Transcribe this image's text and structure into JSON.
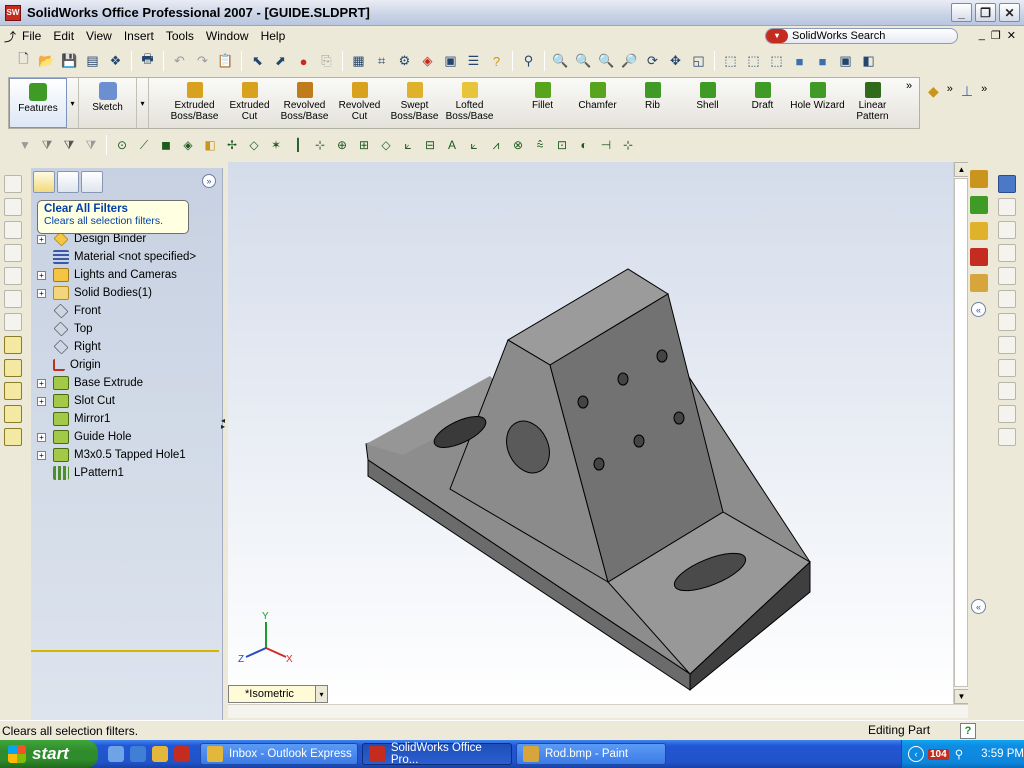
{
  "window": {
    "title": "SolidWorks Office Professional 2007 - [GUIDE.SLDPRT]",
    "app_icon": "SW"
  },
  "menu": {
    "items": [
      "File",
      "Edit",
      "View",
      "Insert",
      "Tools",
      "Window",
      "Help"
    ],
    "search_label": "SolidWorks Search"
  },
  "command_manager": {
    "tabs": [
      {
        "label": "Features",
        "icon": "features-icon"
      },
      {
        "label": "Sketch",
        "icon": "sketch-icon"
      }
    ],
    "commands": [
      {
        "label": "Extruded Boss/Base",
        "icon": "extruded-boss-icon",
        "color": "#d9a21e"
      },
      {
        "label": "Extruded Cut",
        "icon": "extruded-cut-icon",
        "color": "#d9a21e"
      },
      {
        "label": "Revolved Boss/Base",
        "icon": "revolved-boss-icon",
        "color": "#c07b1b"
      },
      {
        "label": "Revolved Cut",
        "icon": "revolved-cut-icon",
        "color": "#d9a21e"
      },
      {
        "label": "Swept Boss/Base",
        "icon": "swept-boss-icon",
        "color": "#e0b22c"
      },
      {
        "label": "Lofted Boss/Base",
        "icon": "lofted-boss-icon",
        "color": "#e8c43a"
      },
      {
        "label": "Fillet",
        "icon": "fillet-icon",
        "color": "#57a51c"
      },
      {
        "label": "Chamfer",
        "icon": "chamfer-icon",
        "color": "#57a51c"
      },
      {
        "label": "Rib",
        "icon": "rib-icon",
        "color": "#3f9a26"
      },
      {
        "label": "Shell",
        "icon": "shell-icon",
        "color": "#3f9a26"
      },
      {
        "label": "Draft",
        "icon": "draft-icon",
        "color": "#3f9a26"
      },
      {
        "label": "Hole Wizard",
        "icon": "hole-wizard-icon",
        "color": "#3f9a26"
      },
      {
        "label": "Linear Pattern",
        "icon": "linear-pattern-icon",
        "color": "#2f6b1b"
      }
    ]
  },
  "tooltip": {
    "title": "Clear All Filters",
    "body": "Clears all selection filters."
  },
  "feature_tree": {
    "nodes": [
      {
        "label": "Design Binder",
        "icon": "binder",
        "expand": "+"
      },
      {
        "label": "Material <not specified>",
        "icon": "mat",
        "expand": ""
      },
      {
        "label": "Lights and Cameras",
        "icon": "lights",
        "expand": "+"
      },
      {
        "label": "Solid Bodies(1)",
        "icon": "folder",
        "expand": "+"
      },
      {
        "label": "Front",
        "icon": "plane",
        "expand": ""
      },
      {
        "label": "Top",
        "icon": "plane",
        "expand": ""
      },
      {
        "label": "Right",
        "icon": "plane",
        "expand": ""
      },
      {
        "label": "Origin",
        "icon": "origin",
        "expand": ""
      },
      {
        "label": "Base Extrude",
        "icon": "feat",
        "expand": "+"
      },
      {
        "label": "Slot Cut",
        "icon": "feat",
        "expand": "+"
      },
      {
        "label": "Mirror1",
        "icon": "feat",
        "expand": ""
      },
      {
        "label": "Guide Hole",
        "icon": "feat",
        "expand": "+"
      },
      {
        "label": "M3x0.5 Tapped Hole1",
        "icon": "feat",
        "expand": "+"
      },
      {
        "label": "LPattern1",
        "icon": "pattern",
        "expand": ""
      }
    ]
  },
  "viewport": {
    "view_name": "*Isometric",
    "triad": {
      "x": "X",
      "y": "Y",
      "z": "Z"
    }
  },
  "status": {
    "message": "Clears all selection filters.",
    "mode": "Editing Part",
    "help": "?"
  },
  "taskbar": {
    "start_label": "start",
    "tasks": [
      {
        "label": "Inbox - Outlook Express",
        "active": false,
        "icon": "outlook-icon"
      },
      {
        "label": "SolidWorks Office Pro...",
        "active": true,
        "icon": "solidworks-icon"
      },
      {
        "label": "Rod.bmp - Paint",
        "active": false,
        "icon": "paint-icon"
      }
    ],
    "tray_badge": "104",
    "time": "3:59 PM"
  }
}
